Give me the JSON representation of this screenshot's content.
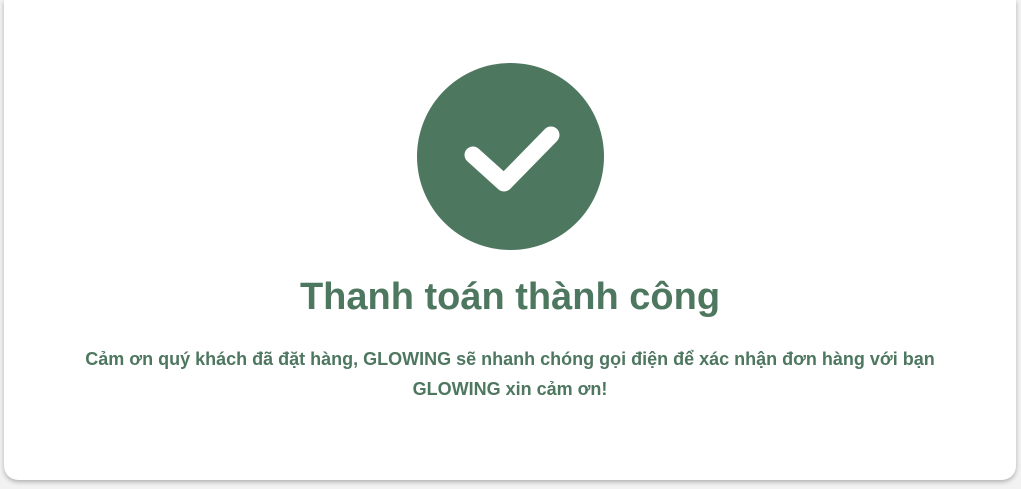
{
  "colors": {
    "accent": "#4e7760",
    "card_background": "#ffffff",
    "page_background": "#f2f2f2"
  },
  "status": {
    "icon": "checkmark-icon",
    "title": "Thanh toán thành công",
    "message_line1": "Cảm ơn quý khách đã đặt hàng, GLOWING sẽ nhanh chóng gọi điện để xác nhận đơn hàng với bạn",
    "message_line2": "GLOWING xin cảm ơn!"
  }
}
